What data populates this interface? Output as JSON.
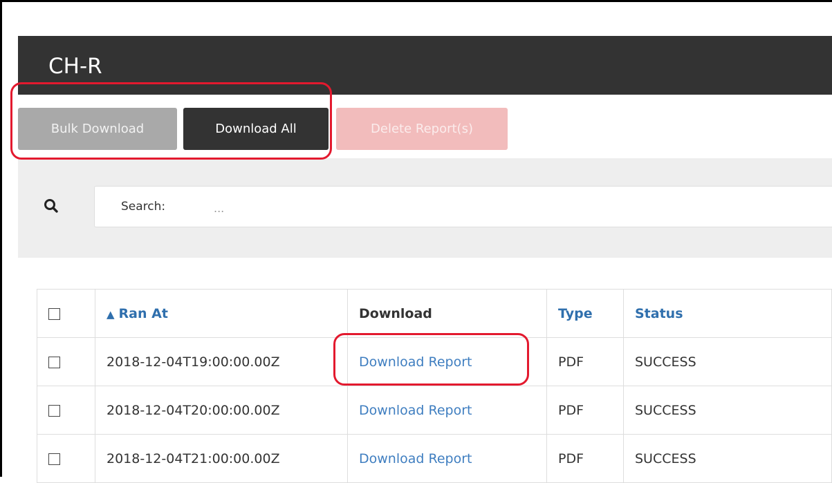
{
  "header": {
    "title": "CH-R"
  },
  "toolbar": {
    "bulk_download_label": "Bulk Download",
    "download_all_label": "Download All",
    "delete_reports_label": "Delete Report(s)"
  },
  "search": {
    "label": "Search:",
    "placeholder": "...",
    "value": ""
  },
  "table": {
    "columns": {
      "ran_at": "Ran At",
      "ran_at_sort": "▲",
      "download": "Download",
      "type": "Type",
      "status": "Status"
    },
    "rows": [
      {
        "ran_at": "2018-12-04T19:00:00.00Z",
        "download": "Download Report",
        "type": "PDF",
        "status": "SUCCESS"
      },
      {
        "ran_at": "2018-12-04T20:00:00.00Z",
        "download": "Download Report",
        "type": "PDF",
        "status": "SUCCESS"
      },
      {
        "ran_at": "2018-12-04T21:00:00.00Z",
        "download": "Download Report",
        "type": "PDF",
        "status": "SUCCESS"
      }
    ]
  },
  "colors": {
    "header_bg": "#333333",
    "link": "#3f7ec0",
    "sort_header": "#2f6fad",
    "annotation": "#e3192e",
    "delete_button": "#f2bcbc",
    "bulk_button": "#a9a9a9"
  },
  "icons": {
    "search": "search-icon"
  }
}
